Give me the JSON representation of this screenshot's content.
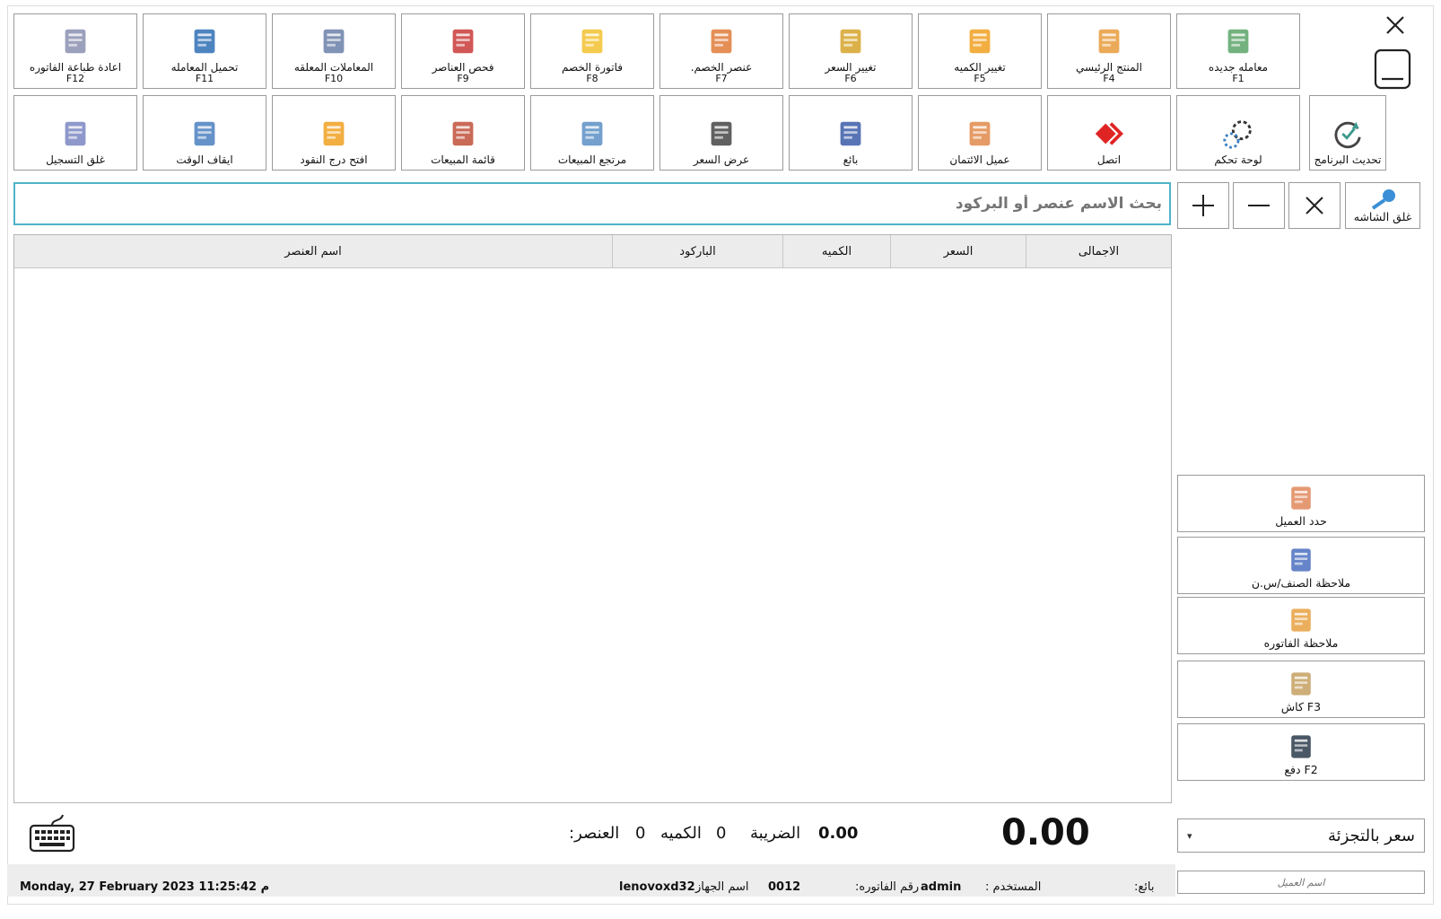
{
  "window": {
    "close_icon": "close-icon",
    "minimize_icon": "minimize-icon"
  },
  "toolbar_row1": [
    {
      "label": "معامله جديده",
      "key": "F1",
      "icon": "new-transaction-icon"
    },
    {
      "label": "المنتج الرئيسي",
      "key": "F4",
      "icon": "main-product-icon"
    },
    {
      "label": "تغيير الكميه",
      "key": "F5",
      "icon": "change-quantity-icon"
    },
    {
      "label": "تغيير السعر",
      "key": "F6",
      "icon": "change-price-icon"
    },
    {
      "label": "عنصر الخصم.",
      "key": "F7",
      "icon": "discount-item-icon"
    },
    {
      "label": "فاتورة الخصم",
      "key": "F8",
      "icon": "discount-invoice-icon"
    },
    {
      "label": "فحص العناصر",
      "key": "F9",
      "icon": "barcode-icon"
    },
    {
      "label": "المعاملات المعلقه",
      "key": "F10",
      "icon": "pending-transactions-icon"
    },
    {
      "label": "تحميل المعامله",
      "key": "F11",
      "icon": "load-transaction-icon"
    },
    {
      "label": "اعادة طباعة الفاتوره",
      "key": "F12",
      "icon": "printer-icon"
    }
  ],
  "toolbar_row2": [
    {
      "label": "تحديث البرنامج",
      "icon": "refresh-icon"
    },
    {
      "label": "لوحة تحكم",
      "icon": "gear-icon"
    },
    {
      "label": "اتصل",
      "icon": "connect-icon"
    },
    {
      "label": "عميل الائتمان",
      "icon": "credit-customer-icon"
    },
    {
      "label": "بائع",
      "icon": "seller-icon"
    },
    {
      "label": "عرض السعر",
      "icon": "price-quote-icon"
    },
    {
      "label": "مرتجع المبيعات",
      "icon": "sales-return-icon"
    },
    {
      "label": "قائمة المبيعات",
      "icon": "sales-list-icon"
    },
    {
      "label": "افتح درج النقود",
      "icon": "cash-drawer-icon"
    },
    {
      "label": "ايقاف الوقت",
      "icon": "clock-icon"
    },
    {
      "label": "غلق التسجيل",
      "icon": "register-icon"
    }
  ],
  "small_buttons": {
    "lock_screen_label": "غلق الشاشه",
    "lock_icon": "key-icon",
    "clear_icon": "close-icon",
    "minus_icon": "minus-icon",
    "plus_icon": "plus-icon"
  },
  "search": {
    "placeholder": "بحث الاسم عنصر أو البركود"
  },
  "table": {
    "columns": [
      "الاجمالى",
      "السعر",
      "الكميه",
      "الباركود",
      "اسم العنصر"
    ],
    "rows": []
  },
  "side_buttons": [
    {
      "label": "حدد العميل",
      "icon": "select-customer-icon"
    },
    {
      "label": "ملاحظة الصنف/س.ن",
      "icon": "item-note-icon"
    },
    {
      "label": "ملاحظة الفاتوره",
      "icon": "invoice-note-icon"
    },
    {
      "label": "F3 كاش",
      "icon": "cash-icon"
    },
    {
      "label": "F2 دفع",
      "icon": "card-terminal-icon"
    }
  ],
  "price_type": {
    "selected": "سعر بالتجزئة"
  },
  "customer_name": {
    "placeholder": "اسم العميل"
  },
  "totals": {
    "grand_total": "0.00",
    "tax_label": "الضريبة",
    "tax_value": "0.00",
    "quantity_label": "الكميه",
    "quantity_value": "0",
    "item_label": "العنصر:",
    "item_value": "0",
    "keyboard_icon": "keyboard-icon"
  },
  "status_bar": {
    "datetime": "Monday, 27 February 2023 11:25:42 م",
    "device_label": "اسم الجهاز",
    "device_value": "lenovoxd32",
    "invoice_label": "رقم الفاتوره:",
    "invoice_value": "0012",
    "user_label": "المستخدم :",
    "user_value": "admin",
    "seller_label": "بائع:"
  },
  "colors": {
    "accent": "#4fb3c9",
    "header_bg": "#ececec",
    "status_bg": "#ededed"
  }
}
